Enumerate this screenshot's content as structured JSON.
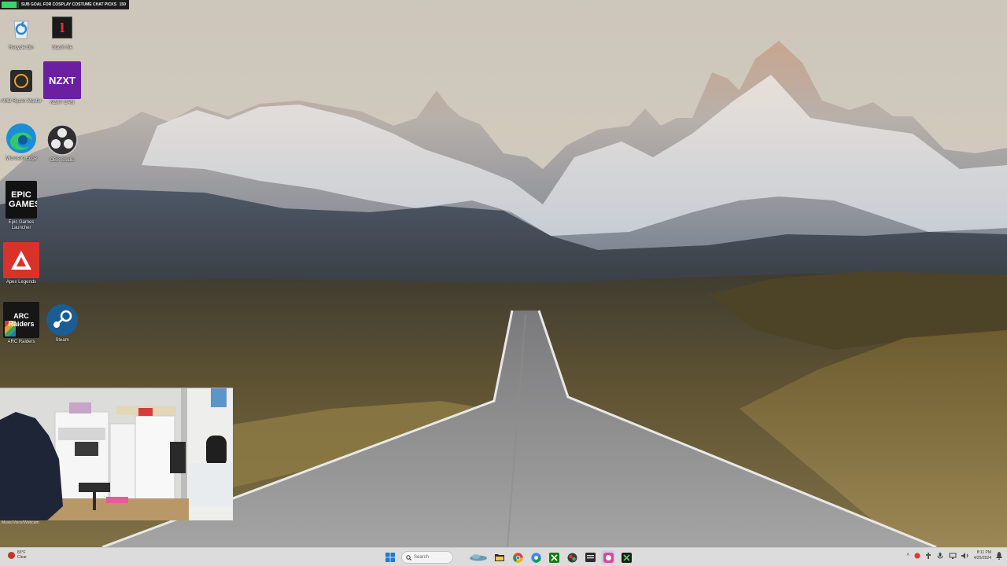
{
  "overlay": {
    "sub_goal_text": "SUB GOAL FOR COSPLAY COSTUME CHAT PICKS",
    "sub_goal_count": "150",
    "progress_fraction": 0.85,
    "accent_color": "#37d86b"
  },
  "desktop_icons": [
    {
      "label": "Recycle Bin",
      "icon": "recycle-bin-icon"
    },
    {
      "label": "Stas'h file",
      "icon": "stash-file-icon"
    },
    {
      "label": "AMD Ryzen Master",
      "icon": "ryzen-master-icon"
    },
    {
      "label": "NZXT CAM",
      "icon": "nzxt-cam-icon",
      "text": "NZXT"
    },
    {
      "label": "Microsoft Edge",
      "icon": "edge-icon"
    },
    {
      "label": "OBS Studio",
      "icon": "obs-icon"
    },
    {
      "label": "Epic Games Launcher",
      "icon": "epic-games-icon",
      "text": "EPIC GAMES"
    },
    {
      "label": "Apex Legends",
      "icon": "apex-legends-icon"
    },
    {
      "label": "ARC Raiders",
      "icon": "arc-raiders-icon",
      "text": "ARC Raiders"
    },
    {
      "label": "Steam",
      "icon": "steam-icon"
    }
  ],
  "webcam": {
    "caption": "Music/Voice/Webcam"
  },
  "taskbar": {
    "weather_temp": "83°F",
    "weather_cond": "Clear",
    "search_placeholder": "Search",
    "apps": [
      "start-icon",
      "search-icon",
      "cloud-icon",
      "file-explorer-icon",
      "chrome-icon",
      "chrome-alt-icon",
      "xbox-icon",
      "app-icon",
      "terminal-icon",
      "obs-taskbar-icon",
      "xbox-game-bar-icon"
    ],
    "clock_time": "8:11 PM",
    "clock_date": "4/25/2024"
  }
}
